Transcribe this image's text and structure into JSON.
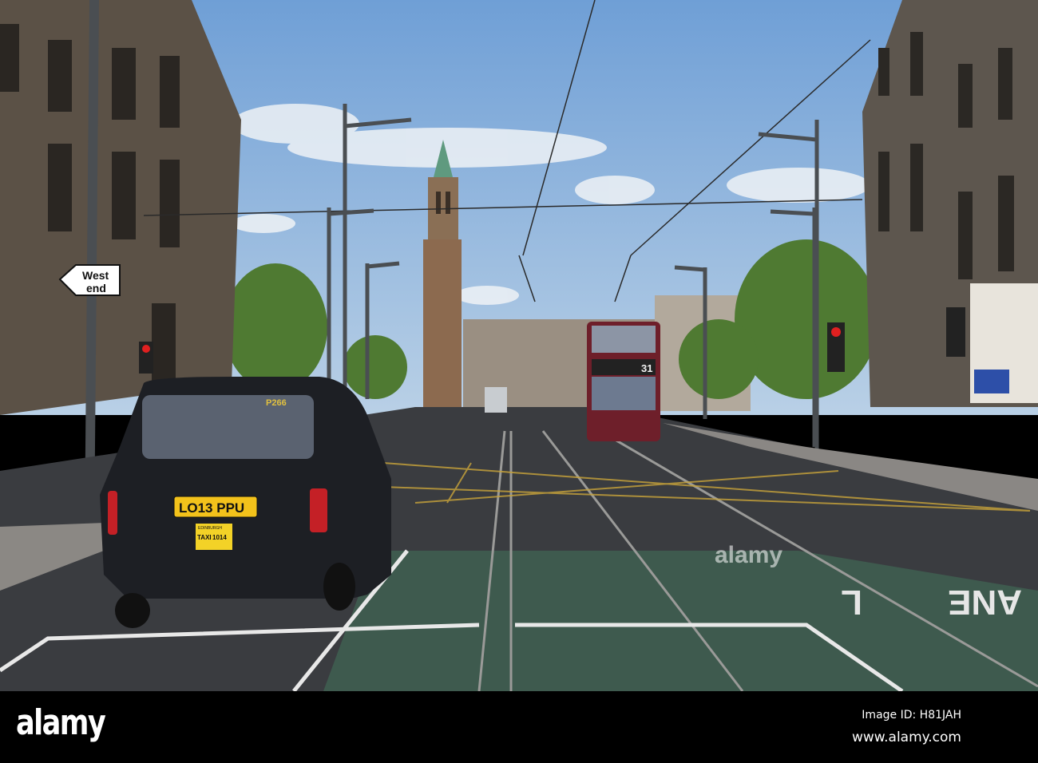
{
  "photo": {
    "street_sign": {
      "line1": "West",
      "line2": "end"
    },
    "taxi": {
      "fleet_number": "P266",
      "plate": "LO13 PPU",
      "licence_city": "EDINBURGH",
      "licence_label": "TAXI",
      "licence_number": "1014"
    },
    "bus": {
      "route": "31"
    },
    "road_marking": {
      "part1": "ANE",
      "part2": "L"
    },
    "colors": {
      "sky": "#8fb6e0",
      "road": "#3a3c40",
      "tram_lane": "#3e5a4e",
      "taxi": "#1d1f24",
      "bus": "#6e1f2a",
      "stone": "#5b5146"
    }
  },
  "watermark": {
    "logo": "alamy",
    "image_id": "Image ID: H81JAH",
    "website": "www.alamy.com",
    "overlay_text": "alamy"
  }
}
